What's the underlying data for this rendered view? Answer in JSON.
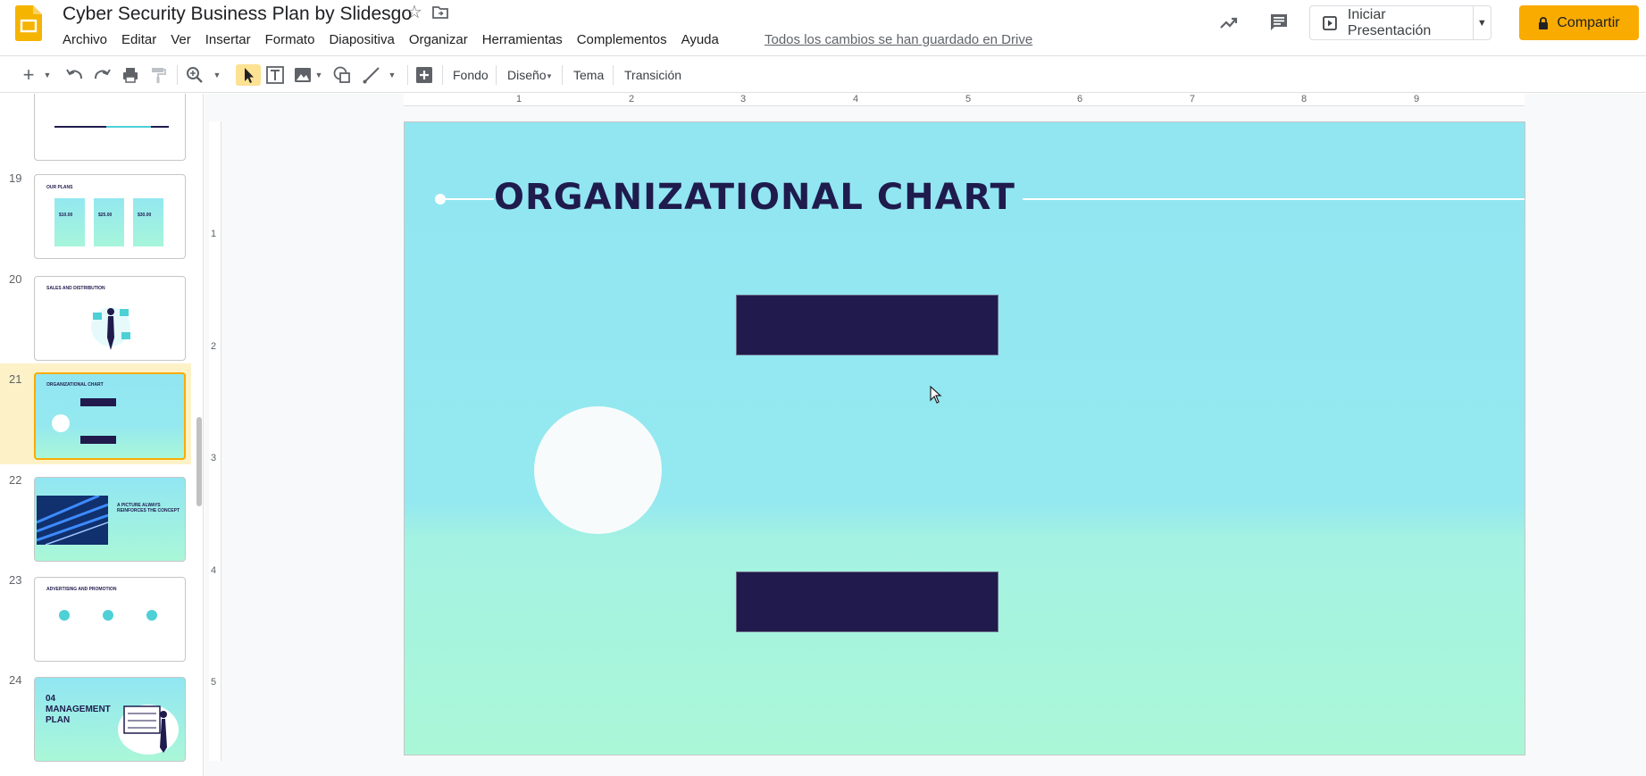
{
  "document": {
    "title": "Cyber Security Business Plan by Slidesgo",
    "saved_status": "Todos los cambios se han guardado en Drive"
  },
  "menu": [
    "Archivo",
    "Editar",
    "Ver",
    "Insertar",
    "Formato",
    "Diapositiva",
    "Organizar",
    "Herramientas",
    "Complementos",
    "Ayuda"
  ],
  "header_actions": {
    "present_label": "Iniciar Presentación",
    "share_label": "Compartir",
    "share_color": "#f9ab00"
  },
  "toolbar": {
    "background_label": "Fondo",
    "layout_label": "Diseño",
    "theme_label": "Tema",
    "transition_label": "Transición"
  },
  "filmstrip": {
    "slides": [
      {
        "number": "19",
        "title": "OUR PLANS",
        "prices": [
          "$10.00",
          "$25.00",
          "$30.00"
        ]
      },
      {
        "number": "20",
        "title": "SALES AND DISTRIBUTION"
      },
      {
        "number": "21",
        "title": "ORGANIZATIONAL CHART",
        "selected": true
      },
      {
        "number": "22",
        "title": "A PICTURE ALWAYS REINFORCES THE CONCEPT"
      },
      {
        "number": "23",
        "title": "ADVERTISING AND PROMOTION"
      },
      {
        "number": "24",
        "title": "04 MANAGEMENT PLAN"
      }
    ]
  },
  "ruler": {
    "top": [
      "1",
      "2",
      "3",
      "4",
      "5",
      "6",
      "7",
      "8",
      "9"
    ],
    "left": [
      "1",
      "2",
      "3",
      "4",
      "5"
    ]
  },
  "slide": {
    "title": "ORGANIZATIONAL CHART",
    "colors": {
      "background_top": "#91e6f2",
      "background_bottom": "#aaf7d8",
      "title": "#1f1b4d",
      "box": "#201b4c",
      "circle": "#f8fbfb"
    }
  }
}
